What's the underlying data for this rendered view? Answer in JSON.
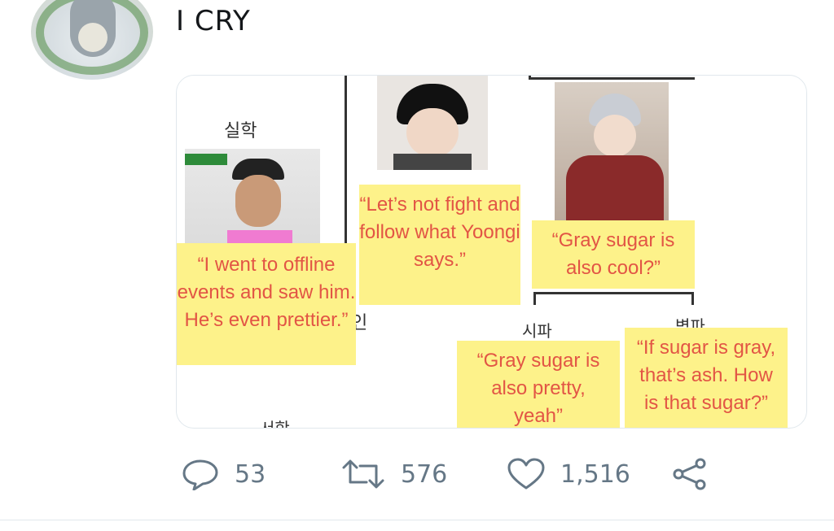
{
  "tweet": {
    "text": "I CRY"
  },
  "media": {
    "labels": {
      "top_left": "실학",
      "middle": "시파",
      "right": "벽파",
      "bottom_left": "서학",
      "fragment": "인"
    },
    "notes": [
      "“I went to offline events and saw him. He’s even prettier.”",
      "“Let’s not fight and follow what Yoongi says.”",
      "“Gray sugar is also cool?”",
      "“Gray sugar is also pretty, yeah”",
      "“If sugar is gray, that’s ash. How is that sugar?”"
    ]
  },
  "actions": {
    "replies": "53",
    "retweets": "576",
    "likes": "1,516"
  },
  "colors": {
    "note_bg": "#fdf28a",
    "note_text": "#e25545",
    "icon": "#657786"
  }
}
